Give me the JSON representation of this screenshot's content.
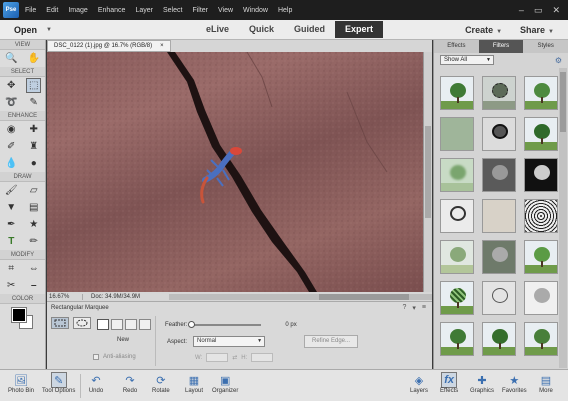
{
  "menubar": {
    "logo": "Pse",
    "items": [
      "File",
      "Edit",
      "Image",
      "Enhance",
      "Layer",
      "Select",
      "Filter",
      "View",
      "Window",
      "Help"
    ],
    "controls": [
      "–",
      "▭",
      "✕"
    ]
  },
  "modebar": {
    "open_label": "Open",
    "modes": [
      "eLive",
      "Quick",
      "Guided",
      "Expert"
    ],
    "active_mode": "Expert",
    "create_label": "Create",
    "share_label": "Share"
  },
  "toolbox": {
    "sections": {
      "view": "VIEW",
      "select": "SELECT",
      "enhance": "ENHANCE",
      "draw": "DRAW",
      "modify": "MODIFY",
      "color": "COLOR"
    }
  },
  "document": {
    "tab_title": "DSC_0122 (1).jpg @ 16.7% (RGB/8)",
    "tab_close": "×",
    "zoom": "16.67%",
    "doc_info": "Doc: 34.9M/34.9M"
  },
  "tool_options": {
    "title": "Rectangular Marquee",
    "new_label": "New",
    "anti_aliasing": "Anti-aliasing",
    "feather_label": "Feather:",
    "feather_value": "0 px",
    "aspect_label": "Aspect:",
    "aspect_value": "Normal",
    "w_label": "W:",
    "h_label": "H:",
    "refine_edge": "Refine Edge...",
    "feather_level": 0
  },
  "panel": {
    "tabs": [
      "Effects",
      "Filters",
      "Styles"
    ],
    "active_tab": "Filters",
    "show_all": "Show All"
  },
  "taskbar": {
    "photo_bin": "Photo Bin",
    "tool_options": "Tool Options",
    "undo": "Undo",
    "redo": "Redo",
    "rotate": "Rotate",
    "layout": "Layout",
    "organizer": "Organizer",
    "layers": "Layers",
    "effects": "Effects",
    "graphics": "Graphics",
    "favorites": "Favorites",
    "more": "More"
  },
  "colors": {
    "accent": "#3b6fb0",
    "canvas_rock": "#8a5c5c",
    "lizard_body": "#4a6fc0",
    "lizard_head": "#d9483a"
  }
}
